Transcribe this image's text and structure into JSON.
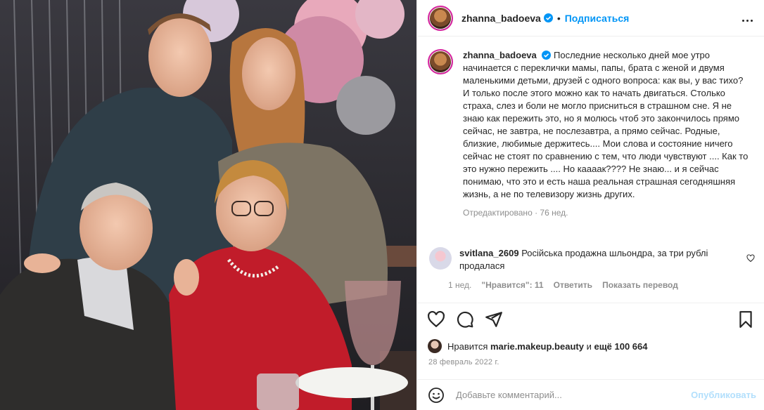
{
  "post": {
    "username": "zhanna_badoeva",
    "follow_label": "Подписаться",
    "dot": "•",
    "caption": "Последние несколько дней мое утро начинается с переклички мамы, папы, брата с женой и двумя маленькими детьми, друзей с одного вопроса: как вы, у вас тихо? И только после этого можно как то начать двигаться. Столько страха, слез и боли не могло присниться в страшном сне. Я не знаю как пережить это, но я молюсь чтоб это закончилось прямо сейчас, не завтра, не послезавтра, а прямо сейчас. Родные, близкие, любимые держитесь.... Мои слова и состояние ничего сейчас не стоят по сравнению с тем, что люди чувствуют .... Как то это нужно пережить .... Но кааaак???? Не знаю... и я сейчас понимаю, что это и есть наша реальная страшная сегодняшняя жизнь, а не по телевизору жизнь других.",
    "edited": "Отредактировано · 76 нед."
  },
  "comment": {
    "username": "svitlana_2609",
    "text": "Російська продажна шльондра, за три рублі продалася",
    "age": "1 нед.",
    "likes": "\"Нравится\": 11",
    "reply": "Ответить",
    "translate": "Показать перевод"
  },
  "likes": {
    "prefix": "Нравится",
    "user": "marie.makeup.beauty",
    "middle": "и",
    "rest": "ещё 100 664"
  },
  "date": "28 февраль 2022 г.",
  "add_comment": {
    "placeholder": "Добавьте комментарий...",
    "publish": "Опубликовать"
  },
  "icons": [
    "more-icon",
    "verified-icon",
    "heart-icon",
    "comment-icon",
    "share-icon",
    "bookmark-icon",
    "smile-icon"
  ],
  "colors": {
    "accent": "#0095f6",
    "muted": "#8e8e8e",
    "publish_disabled": "#b2dffc"
  }
}
